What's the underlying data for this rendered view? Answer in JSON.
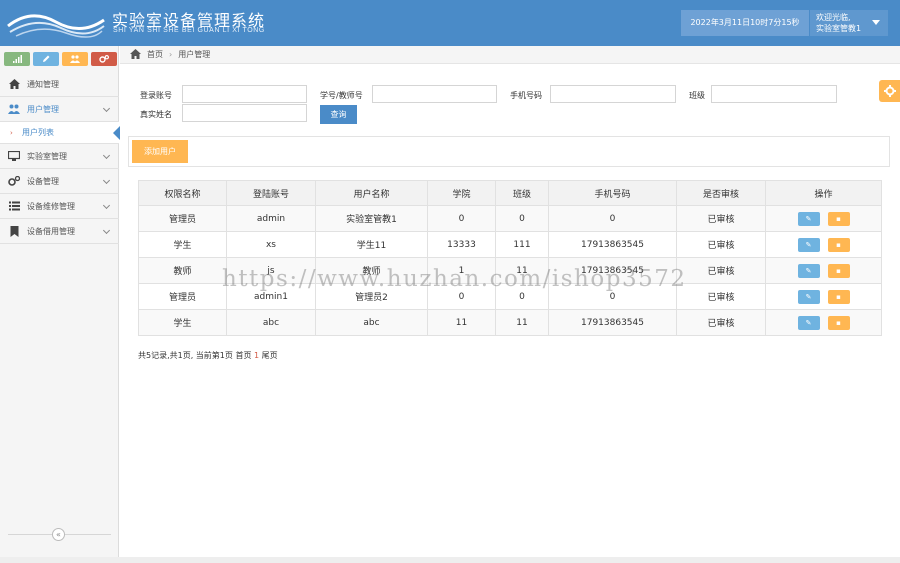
{
  "header": {
    "title": "实验室设备管理系统",
    "subtitle": "SHI YAN SHI SHE BEI GUAN LI XI TONG",
    "datetime": "2022年3月11日10时7分15秒",
    "welcome": "欢迎光临,",
    "username": "实验室管教1",
    "brand_color": "#4a8bc8"
  },
  "sidebar": {
    "shortcuts": [
      {
        "icon": "signal-icon",
        "color": "#87b87f"
      },
      {
        "icon": "pencil-icon",
        "color": "#6fb3e0"
      },
      {
        "icon": "users-icon",
        "color": "#ffb752"
      },
      {
        "icon": "cogs-icon",
        "color": "#d15b47"
      }
    ],
    "items": [
      {
        "label": "通知管理",
        "icon": "home-icon"
      },
      {
        "label": "用户管理",
        "icon": "users-icon",
        "open": true
      },
      {
        "label": "实验室管理",
        "icon": "desktop-icon"
      },
      {
        "label": "设备管理",
        "icon": "cogs-icon"
      },
      {
        "label": "设备维修管理",
        "icon": "list-icon"
      },
      {
        "label": "设备借用管理",
        "icon": "bookmark-icon"
      }
    ],
    "sub_items": [
      {
        "label": "用户列表",
        "active": true
      }
    ]
  },
  "breadcrumb": {
    "home": "首页",
    "current": "用户管理"
  },
  "search": {
    "account_label": "登录账号",
    "account_value": "",
    "number_label": "学号/教师号",
    "number_value": "",
    "phone_label": "手机号码",
    "phone_value": "",
    "class_label": "班级",
    "class_value": "",
    "realname_label": "真实姓名",
    "realname_value": "",
    "query_label": "查询"
  },
  "toolbar": {
    "add_label": "添加用户"
  },
  "table": {
    "columns": [
      "权限名称",
      "登陆账号",
      "用户名称",
      "学院",
      "班级",
      "手机号码",
      "是否审核",
      "操作"
    ],
    "rows": [
      [
        "管理员",
        "admin",
        "实验室管教1",
        "0",
        "0",
        "0",
        "已审核"
      ],
      [
        "学生",
        "xs",
        "学生11",
        "13333",
        "111",
        "17913863545",
        "已审核"
      ],
      [
        "教师",
        "js",
        "教师",
        "1",
        "11",
        "17913863545",
        "已审核"
      ],
      [
        "管理员",
        "admin1",
        "管理员2",
        "0",
        "0",
        "0",
        "已审核"
      ],
      [
        "学生",
        "abc",
        "abc",
        "11",
        "11",
        "17913863545",
        "已审核"
      ]
    ]
  },
  "pager": {
    "summary": "共5记录,共1页, 当前第1页 首页",
    "current": "1",
    "last": "尾页"
  },
  "watermark": "https://www.huzhan.com/ishop3572"
}
